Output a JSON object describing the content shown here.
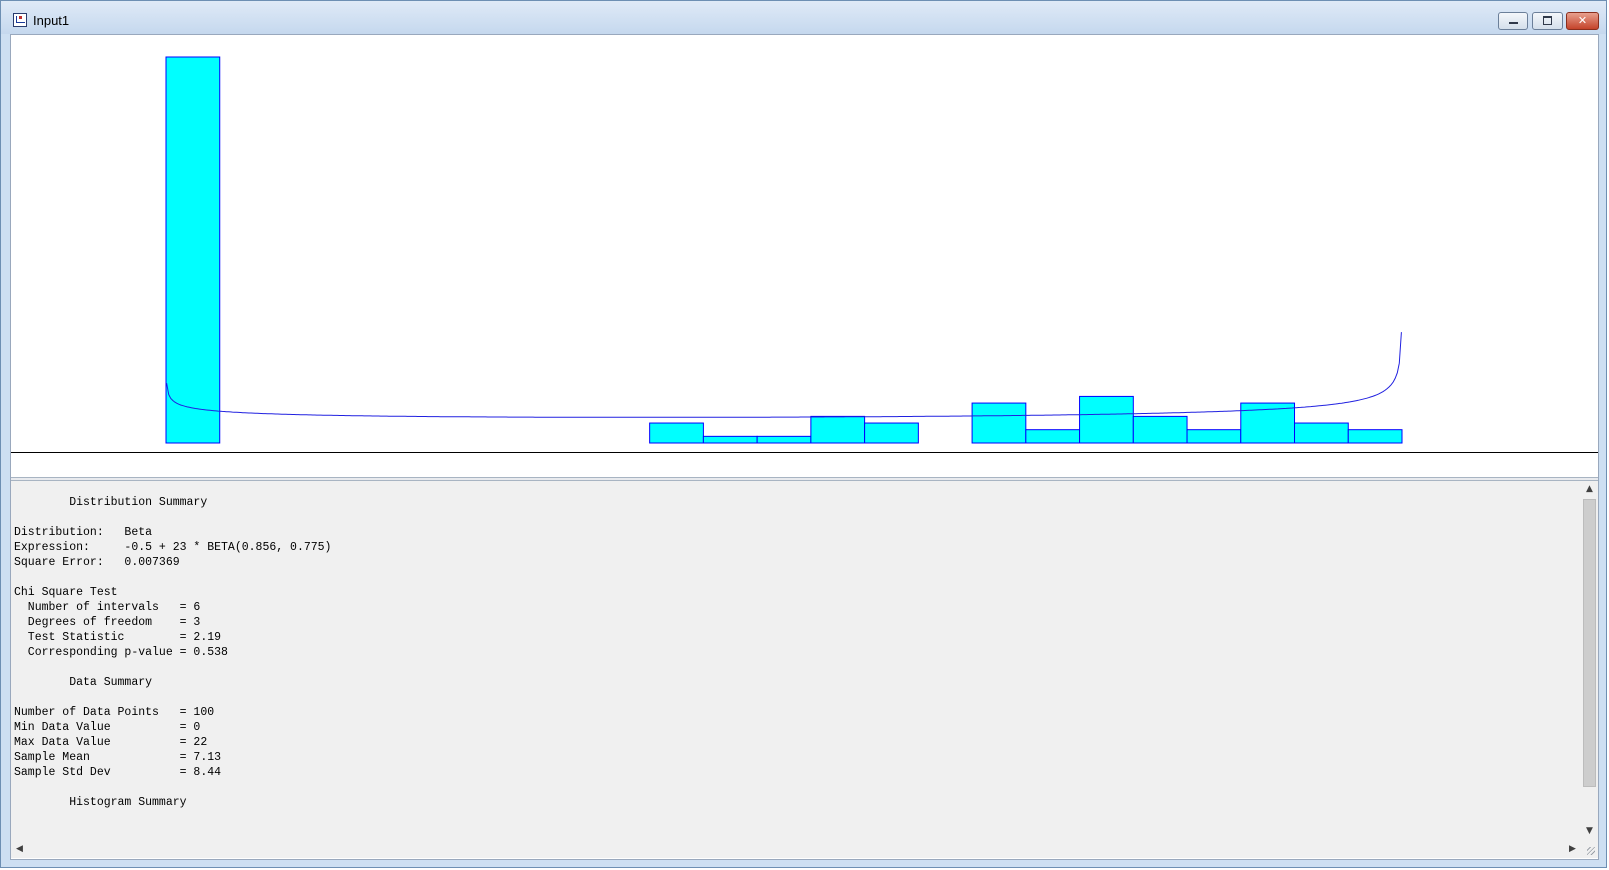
{
  "window": {
    "title": "Input1",
    "icon": "app-document-icon",
    "controls": [
      "minimize-icon",
      "maximize-icon",
      "close-icon"
    ],
    "close_glyph": "✕"
  },
  "colors": {
    "bar_fill": "#00ffff",
    "bar_stroke": "#0000ff",
    "curve": "#2020e0"
  },
  "chart_data": {
    "type": "bar",
    "description_type": "histogram with fitted Beta density curve",
    "bins": [
      {
        "start": -0.5,
        "end": 0.5,
        "count": 29
      },
      {
        "start": 0.5,
        "end": 1.5,
        "count": 0
      },
      {
        "start": 1.5,
        "end": 2.5,
        "count": 0
      },
      {
        "start": 2.5,
        "end": 3.5,
        "count": 0
      },
      {
        "start": 3.5,
        "end": 4.5,
        "count": 0
      },
      {
        "start": 4.5,
        "end": 5.5,
        "count": 0
      },
      {
        "start": 5.5,
        "end": 6.5,
        "count": 0
      },
      {
        "start": 6.5,
        "end": 7.5,
        "count": 0
      },
      {
        "start": 7.5,
        "end": 8.5,
        "count": 0
      },
      {
        "start": 8.5,
        "end": 9.5,
        "count": 1.5
      },
      {
        "start": 9.5,
        "end": 10.5,
        "count": 0.5
      },
      {
        "start": 10.5,
        "end": 11.5,
        "count": 0.5
      },
      {
        "start": 11.5,
        "end": 12.5,
        "count": 2
      },
      {
        "start": 12.5,
        "end": 13.5,
        "count": 1.5
      },
      {
        "start": 13.5,
        "end": 14.5,
        "count": 0
      },
      {
        "start": 14.5,
        "end": 15.5,
        "count": 3
      },
      {
        "start": 15.5,
        "end": 16.5,
        "count": 1
      },
      {
        "start": 16.5,
        "end": 17.5,
        "count": 3.5
      },
      {
        "start": 17.5,
        "end": 18.5,
        "count": 2
      },
      {
        "start": 18.5,
        "end": 19.5,
        "count": 1
      },
      {
        "start": 19.5,
        "end": 20.5,
        "count": 3
      },
      {
        "start": 20.5,
        "end": 21.5,
        "count": 1.5
      },
      {
        "start": 21.5,
        "end": 22.5,
        "count": 1
      }
    ],
    "fit": {
      "distribution": "Beta",
      "offset": -0.5,
      "scale": 23,
      "alpha": 0.856,
      "beta": 0.775
    },
    "xlim": [
      -0.5,
      22.5
    ],
    "ylim": [
      0,
      29
    ],
    "title": "",
    "xlabel": "",
    "ylabel": ""
  },
  "report": {
    "distribution_summary_heading": "        Distribution Summary",
    "distribution_line": "Distribution:   Beta",
    "expression_line": "Expression:     -0.5 + 23 * BETA(0.856, 0.775)",
    "square_error_line": "Square Error:   0.007369",
    "chi_square_heading": "Chi Square Test",
    "chi_lines": [
      "  Number of intervals   = 6",
      "  Degrees of freedom    = 3",
      "  Test Statistic        = 2.19",
      "  Corresponding p-value = 0.538"
    ],
    "data_summary_heading": "        Data Summary",
    "data_lines": [
      "Number of Data Points   = 100",
      "Min Data Value          = 0",
      "Max Data Value          = 22",
      "Sample Mean             = 7.13",
      "Sample Std Dev          = 8.44"
    ],
    "histogram_summary_heading": "        Histogram Summary"
  },
  "scrollbars": {
    "up_glyph": "▲",
    "down_glyph": "▼",
    "left_glyph": "◀",
    "right_glyph": "▶"
  }
}
